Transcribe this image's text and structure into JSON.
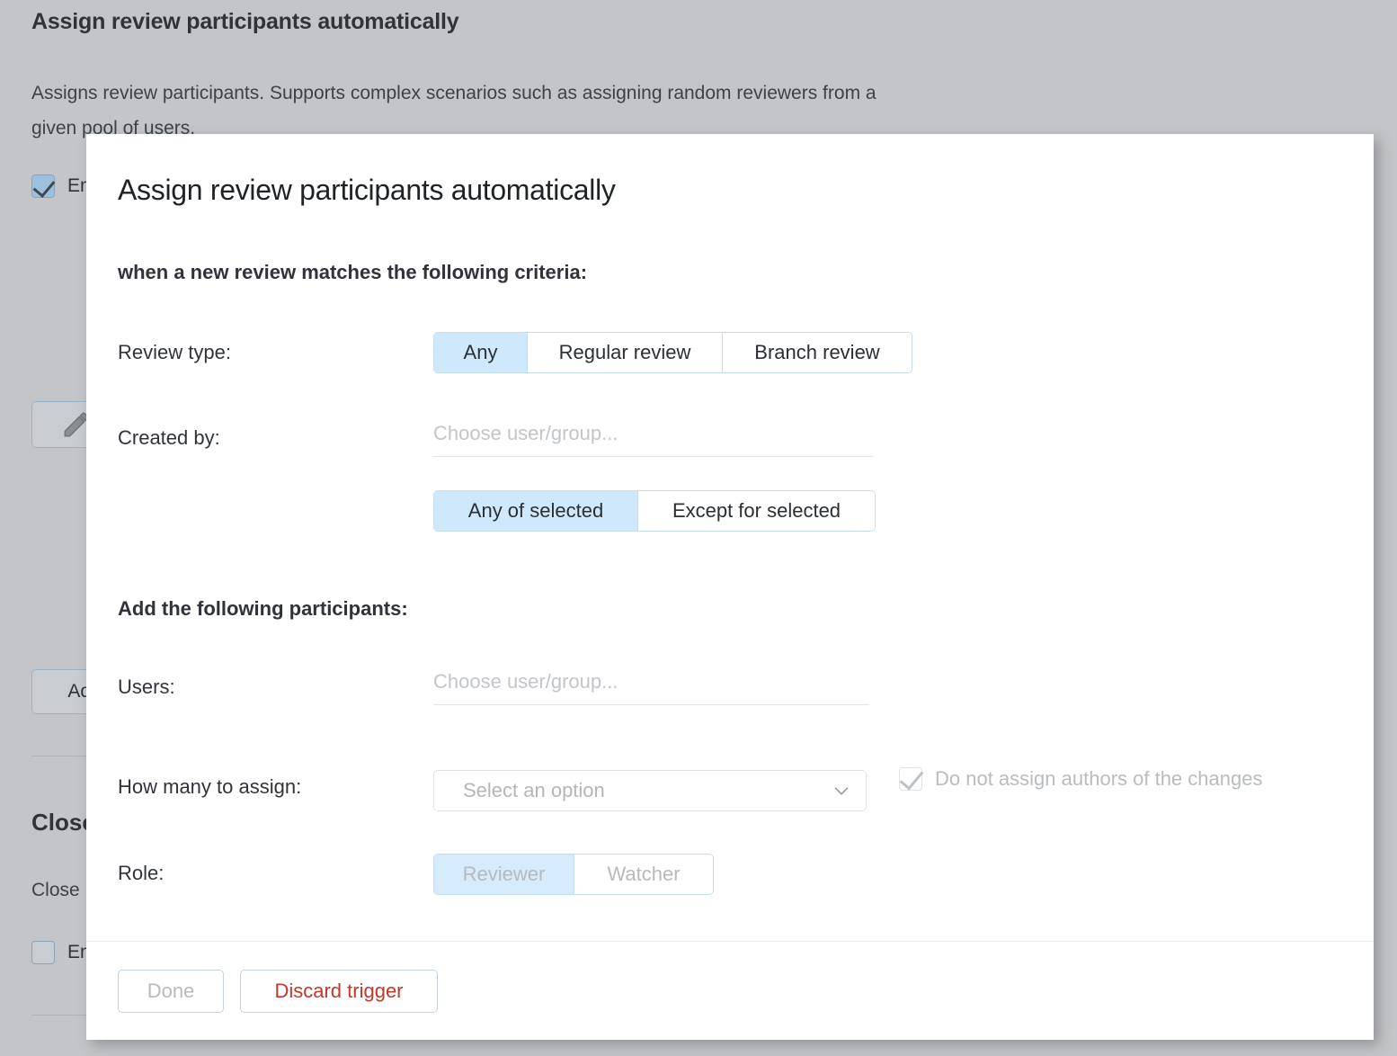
{
  "background": {
    "title": "Assign review participants automatically",
    "description": "Assigns review participants. Supports complex scenarios such as assigning random reviewers from a given pool of users.",
    "enable_checkbox_label": "En",
    "edit_button_icon": "pencil-icon",
    "add_button_label": "Add",
    "second_section_title": "Close",
    "second_section_description": "Close",
    "second_enable_checkbox_label": "En"
  },
  "dialog": {
    "title": "Assign review participants automatically",
    "criteria_section": {
      "heading": "when a new review matches the following criteria:",
      "review_type": {
        "label": "Review type:",
        "options": [
          "Any",
          "Regular review",
          "Branch review"
        ],
        "selected": "Any"
      },
      "created_by": {
        "label": "Created by:",
        "placeholder": "Choose user/group...",
        "value": "",
        "options": [
          "Any of selected",
          "Except for selected"
        ],
        "selected": "Any of selected"
      }
    },
    "participants_section": {
      "heading": "Add the following participants:",
      "users": {
        "label": "Users:",
        "placeholder": "Choose user/group...",
        "value": ""
      },
      "how_many": {
        "label": "How many to assign:",
        "placeholder": "Select an option",
        "value": "",
        "caret_icon": "chevron-down-icon"
      },
      "do_not_assign": {
        "label": "Do not assign authors of the changes",
        "checked": true,
        "disabled": true
      },
      "role": {
        "label": "Role:",
        "options": [
          "Reviewer",
          "Watcher"
        ],
        "selected": "Reviewer",
        "disabled": true
      }
    },
    "footer": {
      "done_label": "Done",
      "discard_label": "Discard trigger"
    }
  },
  "colors": {
    "accent_selected": "#cfe8fb",
    "accent_border": "#c6dcf0",
    "danger": "#c0392b",
    "page_background": "#c3c5c8",
    "dialog_background": "#ffffff",
    "disabled_text": "#b7babd"
  }
}
